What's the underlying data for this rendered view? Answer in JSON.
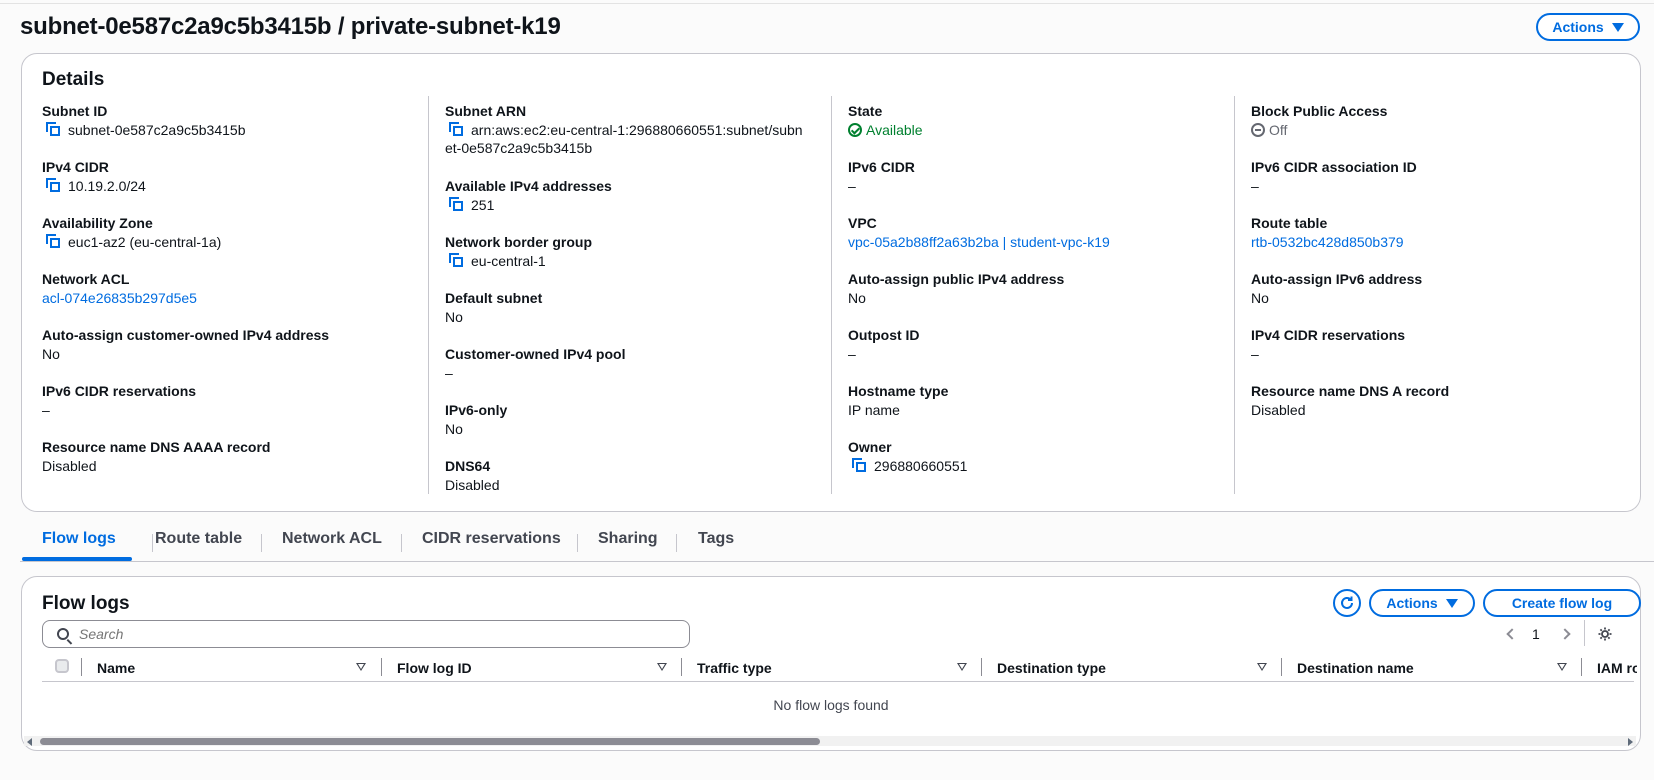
{
  "page": {
    "title": "subnet-0e587c2a9c5b3415b / private-subnet-k19",
    "actions_label": "Actions"
  },
  "details": {
    "title": "Details",
    "col1": [
      {
        "label": "Subnet ID",
        "value": "subnet-0e587c2a9c5b3415b",
        "copy": true
      },
      {
        "label": "IPv4 CIDR",
        "value": "10.19.2.0/24",
        "copy": true
      },
      {
        "label": "Availability Zone",
        "value": "euc1-az2 (eu-central-1a)",
        "copy": true
      },
      {
        "label": "Network ACL",
        "value": "acl-074e26835b297d5e5",
        "link": true
      },
      {
        "label": "Auto-assign customer-owned IPv4 address",
        "value": "No"
      },
      {
        "label": "IPv6 CIDR reservations",
        "value": "–"
      },
      {
        "label": "Resource name DNS AAAA record",
        "value": "Disabled"
      }
    ],
    "col2": [
      {
        "label": "Subnet ARN",
        "value_line1": "arn:aws:ec2:eu-central-1:296880660551:subnet/subn",
        "value_line2": "et-0e587c2a9c5b3415b",
        "copy": true
      },
      {
        "label": "Available IPv4 addresses",
        "value": "251",
        "copy": true
      },
      {
        "label": "Network border group",
        "value": "eu-central-1",
        "copy": true
      },
      {
        "label": "Default subnet",
        "value": "No"
      },
      {
        "label": "Customer-owned IPv4 pool",
        "value": "–"
      },
      {
        "label": "IPv6-only",
        "value": "No"
      },
      {
        "label": "DNS64",
        "value": "Disabled"
      }
    ],
    "col3": [
      {
        "label": "State",
        "value": "Available",
        "status": "ok"
      },
      {
        "label": "IPv6 CIDR",
        "value": "–"
      },
      {
        "label": "VPC",
        "value": "vpc-05a2b88ff2a63b2ba | student-vpc-k19",
        "link": true
      },
      {
        "label": "Auto-assign public IPv4 address",
        "value": "No"
      },
      {
        "label": "Outpost ID",
        "value": "–"
      },
      {
        "label": "Hostname type",
        "value": "IP name"
      },
      {
        "label": "Owner",
        "value": "296880660551",
        "copy": true
      }
    ],
    "col4": [
      {
        "label": "Block Public Access",
        "value": "Off",
        "status": "off"
      },
      {
        "label": "IPv6 CIDR association ID",
        "value": "–"
      },
      {
        "label": "Route table",
        "value": "rtb-0532bc428d850b379",
        "link": true
      },
      {
        "label": "Auto-assign IPv6 address",
        "value": "No"
      },
      {
        "label": "IPv4 CIDR reservations",
        "value": "–"
      },
      {
        "label": "Resource name DNS A record",
        "value": "Disabled"
      }
    ]
  },
  "tabs": [
    "Flow logs",
    "Route table",
    "Network ACL",
    "CIDR reservations",
    "Sharing",
    "Tags"
  ],
  "flowlogs": {
    "title": "Flow logs",
    "actions_label": "Actions",
    "create_label": "Create flow log",
    "search_placeholder": "Search",
    "page_number": "1",
    "columns": [
      "Name",
      "Flow log ID",
      "Traffic type",
      "Destination type",
      "Destination name",
      "IAM ro"
    ],
    "empty_text": "No flow logs found"
  }
}
